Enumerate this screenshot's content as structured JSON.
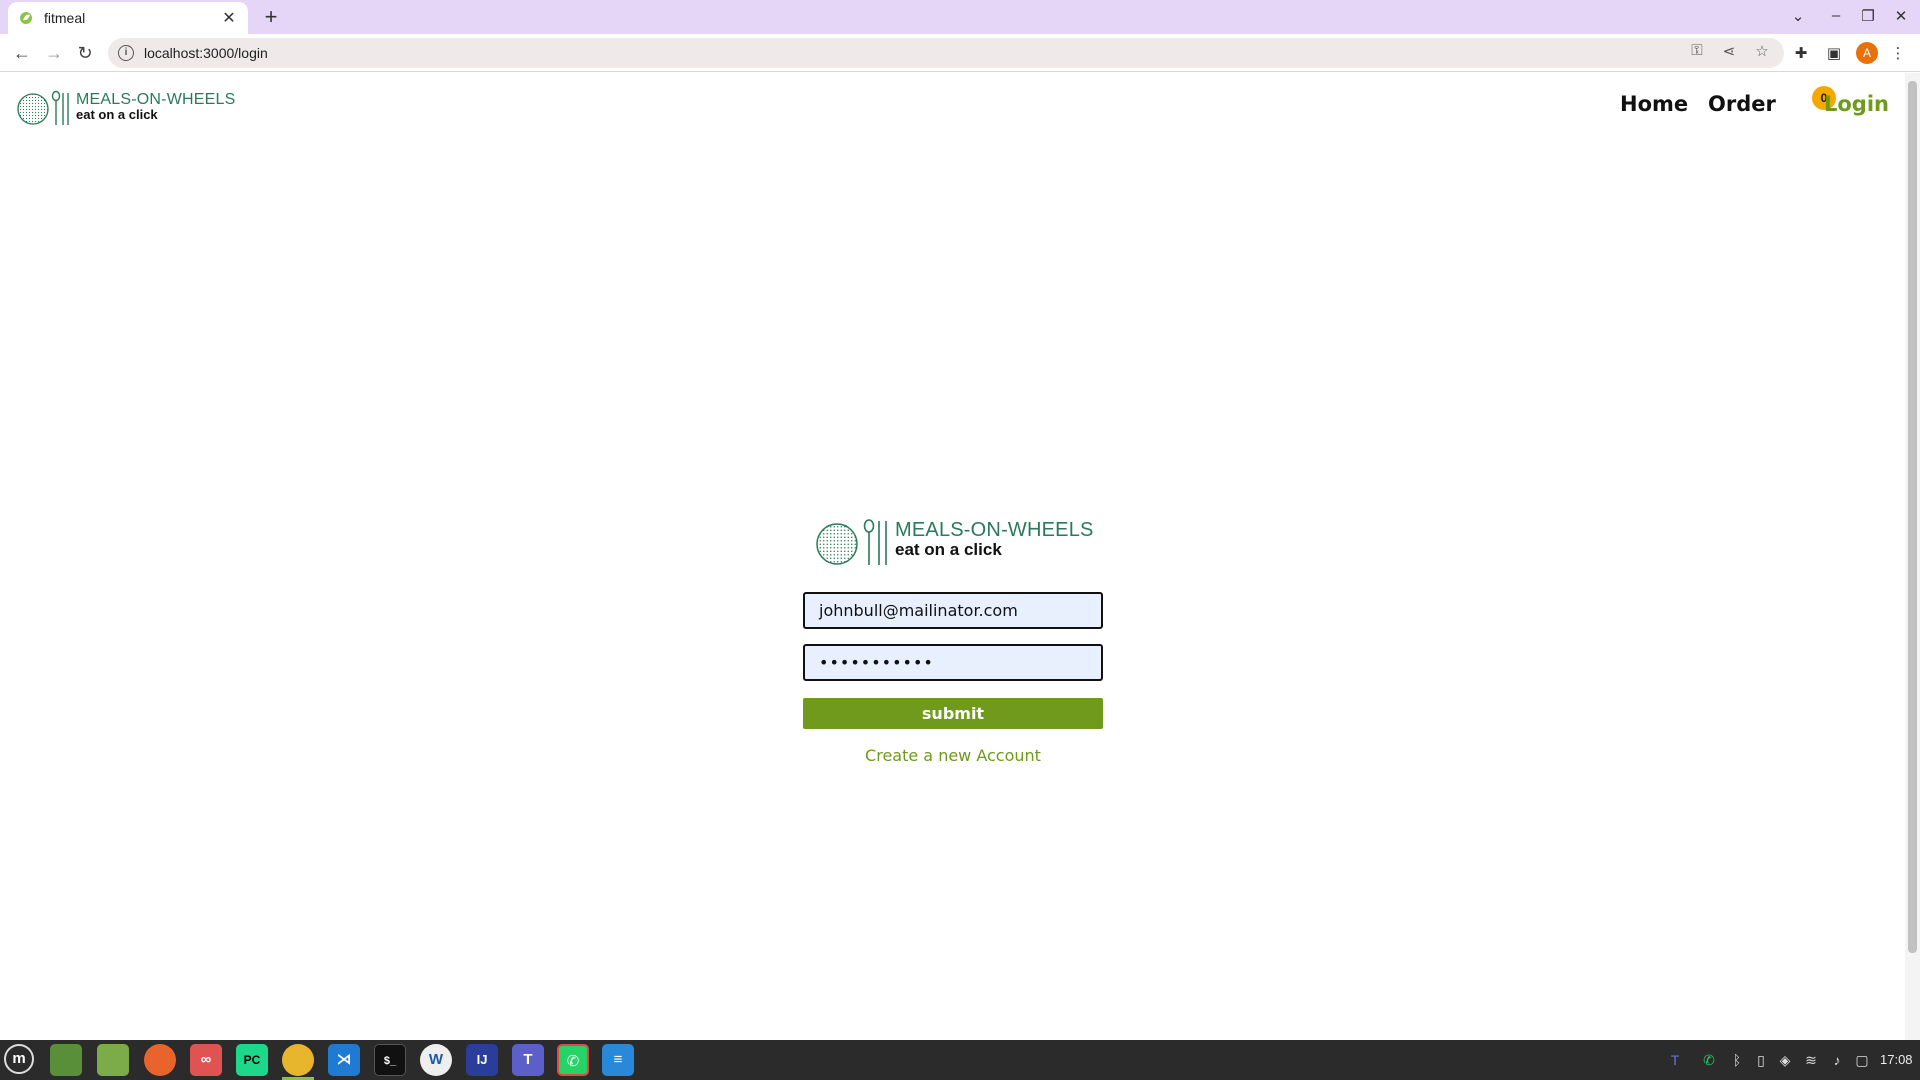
{
  "browser": {
    "tab_title": "fitmeal",
    "url": "localhost:3000/login",
    "avatar_letter": "A"
  },
  "header": {
    "brand": "MEALS-ON-WHEELS",
    "tagline": "eat on a click",
    "nav": {
      "home": "Home",
      "order": "Order",
      "login": "Login"
    },
    "cart_count": "0"
  },
  "login_form": {
    "brand": "MEALS-ON-WHEELS",
    "tagline": "eat on a click",
    "email_value": "johnbull@mailinator.com",
    "password_value": "•••••••••••",
    "submit_label": "submit",
    "create_account_label": "Create a new Account"
  },
  "taskbar": {
    "clock": "17:08",
    "apps": [
      "menu",
      "desktop",
      "files",
      "firefox",
      "infinity",
      "pycharm",
      "chrome",
      "vscode",
      "terminal",
      "writer",
      "intellij",
      "teams",
      "whatsapp",
      "notes"
    ]
  },
  "colors": {
    "accent_green": "#6f9a1c",
    "brand_teal": "#2a7a5a",
    "tab_bar": "#e5d5f7",
    "field_bg": "#e8f0fe",
    "badge": "#f5a800"
  }
}
